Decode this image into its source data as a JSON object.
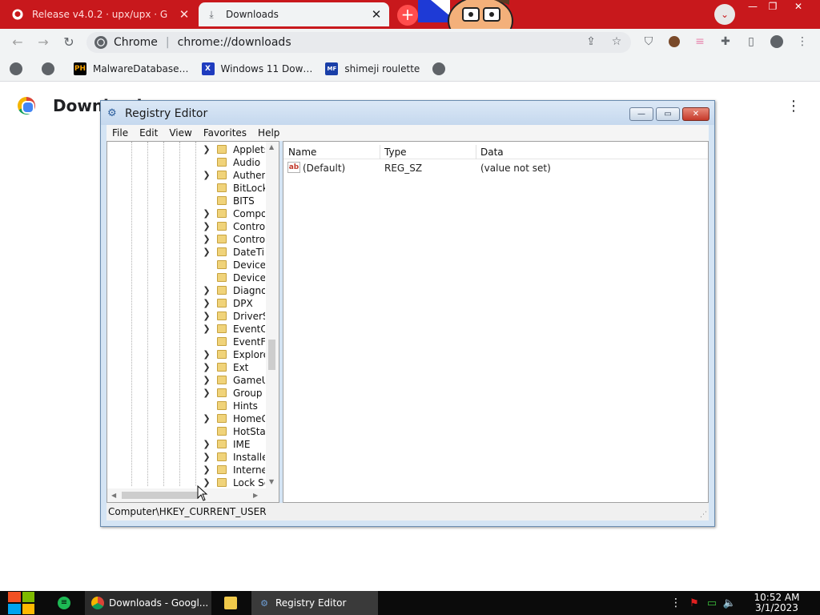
{
  "browser": {
    "tabs": [
      {
        "label": "Release v4.0.2 · upx/upx · G",
        "icon": "github-icon"
      },
      {
        "label": "Downloads",
        "icon": "download-icon"
      }
    ],
    "new_tab_symbol": "+",
    "tab_search_symbol": "⌄",
    "window_controls": {
      "minimize": "—",
      "maximize": "❐",
      "close": "✕"
    },
    "nav": {
      "back": "←",
      "forward": "→",
      "reload": "↻"
    },
    "omnibox": {
      "site": "Chrome",
      "url": "chrome://downloads"
    },
    "bookmarks": [
      {
        "label": "",
        "icon": "bookmark-icon",
        "icon_text": ""
      },
      {
        "label": "",
        "icon": "bookmark-icon",
        "icon_text": ""
      },
      {
        "label": "MalwareDatabase…",
        "icon": "ph-icon",
        "icon_text": "PH",
        "color": "#f7a200"
      },
      {
        "label": "Windows 11 Dow…",
        "icon": "x-icon",
        "icon_text": "X",
        "color": "#1f3cbf"
      },
      {
        "label": "shimeji roulette",
        "icon": "mft-icon",
        "icon_text": "MF",
        "color": "#1a3fa8"
      },
      {
        "label": "",
        "icon": "bookmark-icon",
        "icon_text": ""
      }
    ],
    "page_title": "Downloads",
    "kebab": "⋮"
  },
  "regedit": {
    "title": "Registry Editor",
    "menu": [
      "File",
      "Edit",
      "View",
      "Favorites",
      "Help"
    ],
    "window_controls": {
      "minimize": "—",
      "maximize": "▭",
      "close": "✕"
    },
    "tree": [
      {
        "label": "Applets",
        "expand": true
      },
      {
        "label": "Audio",
        "expand": false
      },
      {
        "label": "Authentication",
        "expand": true
      },
      {
        "label": "BitLocker",
        "expand": false
      },
      {
        "label": "BITS",
        "expand": false
      },
      {
        "label": "Component",
        "expand": true
      },
      {
        "label": "Control",
        "expand": true
      },
      {
        "label": "Control",
        "expand": true
      },
      {
        "label": "DateTime",
        "expand": true
      },
      {
        "label": "Device",
        "expand": false
      },
      {
        "label": "Device",
        "expand": false
      },
      {
        "label": "Diagnostics",
        "expand": true
      },
      {
        "label": "DPX",
        "expand": true
      },
      {
        "label": "DriverSearching",
        "expand": true
      },
      {
        "label": "EventCollector",
        "expand": true
      },
      {
        "label": "EventForwarding",
        "expand": false
      },
      {
        "label": "Explorer",
        "expand": true
      },
      {
        "label": "Ext",
        "expand": true
      },
      {
        "label": "GameUX",
        "expand": true
      },
      {
        "label": "Group",
        "expand": true
      },
      {
        "label": "Hints",
        "expand": false
      },
      {
        "label": "HomeGroup",
        "expand": true
      },
      {
        "label": "HotStart",
        "expand": false
      },
      {
        "label": "IME",
        "expand": true
      },
      {
        "label": "Installer",
        "expand": true
      },
      {
        "label": "Internet",
        "expand": true
      },
      {
        "label": "Lock Screen",
        "expand": true
      }
    ],
    "list": {
      "columns": [
        "Name",
        "Type",
        "Data"
      ],
      "rows": [
        {
          "name": "(Default)",
          "type": "REG_SZ",
          "data": "(value not set)"
        }
      ]
    },
    "status": "Computer\\HKEY_CURRENT_USER"
  },
  "taskbar": {
    "items": [
      {
        "label": "Downloads - Googl...",
        "icon": "chrome-icon"
      },
      {
        "label": "",
        "icon": "folder-icon"
      },
      {
        "label": "Registry Editor",
        "icon": "regedit-icon"
      }
    ],
    "clock_time": "10:52 AM",
    "clock_date": "3/1/2023"
  }
}
